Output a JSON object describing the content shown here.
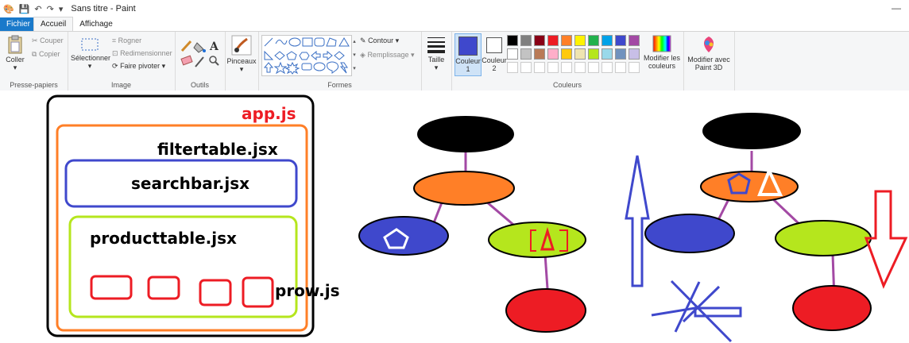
{
  "window": {
    "title": "Sans titre - Paint"
  },
  "tabs": [
    {
      "label": "Fichier"
    },
    {
      "label": "Accueil"
    },
    {
      "label": "Affichage"
    }
  ],
  "ribbon": {
    "clipboard": {
      "paste": "Coller",
      "cut": "Couper",
      "copy": "Copier",
      "group": "Presse-papiers"
    },
    "image": {
      "select": "Sélectionner",
      "crop": "Rogner",
      "resize": "Redimensionner",
      "rotate": "Faire pivoter",
      "group": "Image"
    },
    "tools": {
      "group": "Outils"
    },
    "brushes": {
      "label": "Pinceaux"
    },
    "shapes": {
      "outline": "Contour",
      "fill": "Remplissage",
      "group": "Formes"
    },
    "size": {
      "label": "Taille"
    },
    "colors": {
      "color1": "Couleur 1",
      "color2": "Couleur 2",
      "edit": "Modifier les couleurs",
      "group": "Couleurs",
      "palette_row1": [
        "#000000",
        "#7f7f7f",
        "#880015",
        "#ed1c24",
        "#ff7f27",
        "#fff200",
        "#22b14c",
        "#00a2e8",
        "#3f48cc",
        "#a349a4"
      ],
      "palette_row2": [
        "#ffffff",
        "#c3c3c3",
        "#b97a57",
        "#ffaec9",
        "#ffc90e",
        "#efe4b0",
        "#b5e61d",
        "#99d9ea",
        "#7092be",
        "#c8bfe7"
      ]
    },
    "paint3d": {
      "label": "Modifier avec Paint 3D"
    }
  },
  "canvas": {
    "texts": {
      "app": "app.js",
      "filtertable": "filtertable.jsx",
      "searchbar": "searchbar.jsx",
      "producttable": "producttable.jsx",
      "prow": "prow.js"
    }
  }
}
